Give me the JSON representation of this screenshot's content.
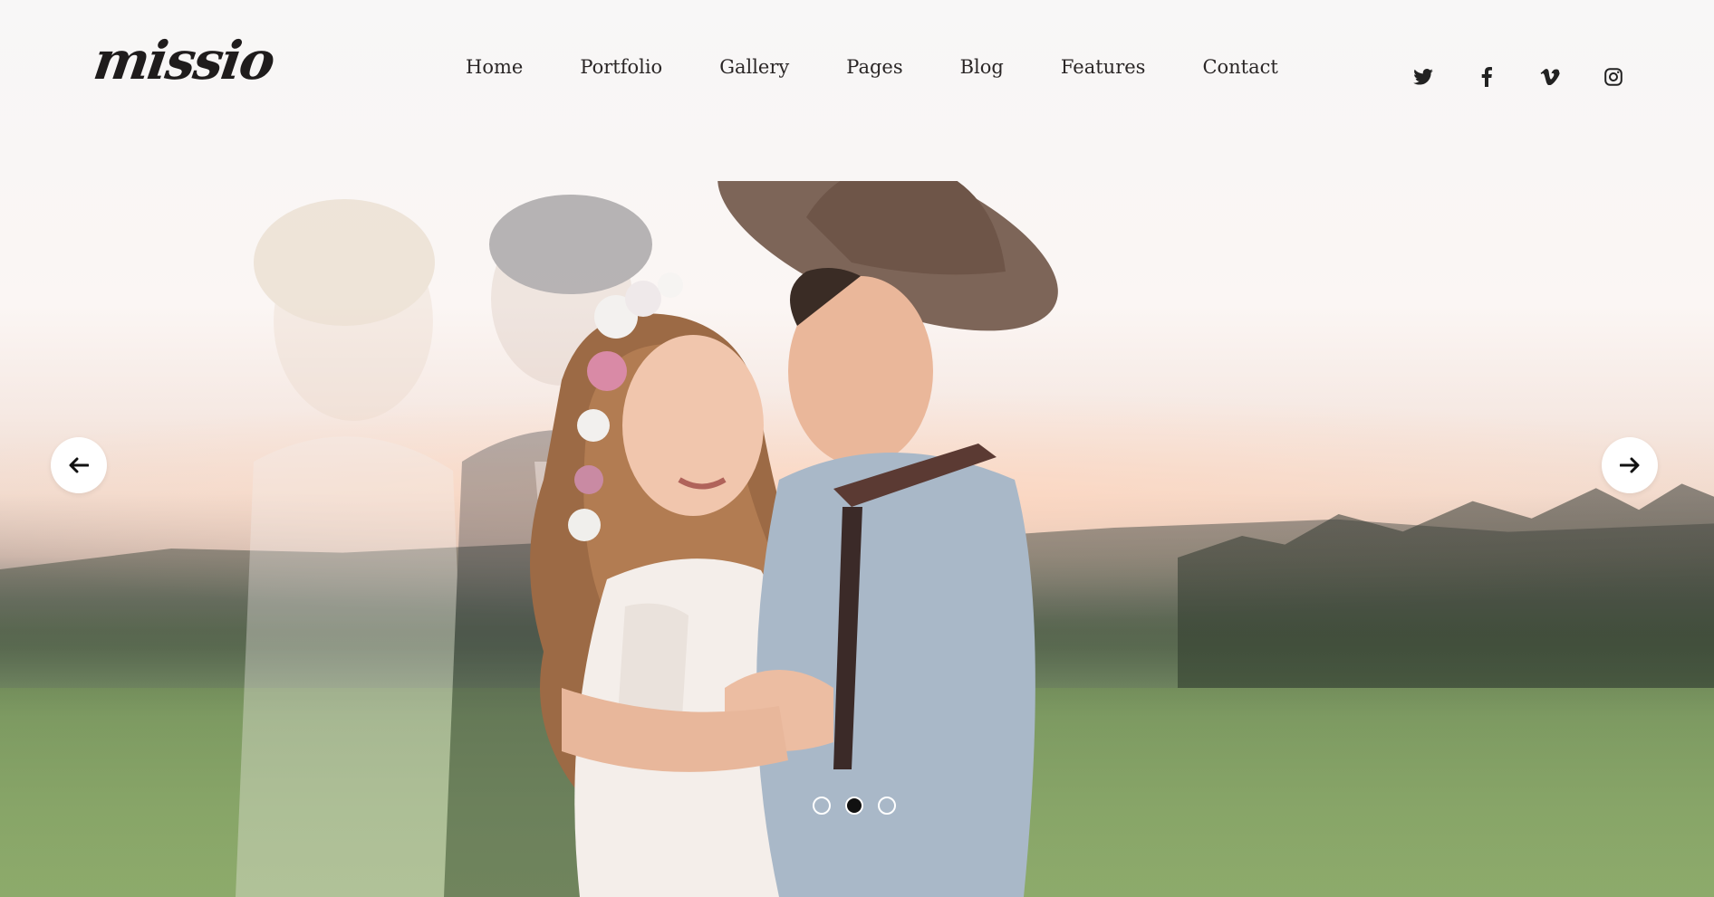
{
  "brand": {
    "logo_text": "missio"
  },
  "nav": {
    "items": [
      {
        "label": "Home"
      },
      {
        "label": "Portfolio"
      },
      {
        "label": "Gallery"
      },
      {
        "label": "Pages"
      },
      {
        "label": "Blog"
      },
      {
        "label": "Features"
      },
      {
        "label": "Contact"
      }
    ]
  },
  "social": {
    "icons": [
      "twitter-icon",
      "facebook-icon",
      "vimeo-icon",
      "instagram-icon"
    ]
  },
  "slider": {
    "prev_icon": "arrow-left-icon",
    "next_icon": "arrow-right-icon",
    "slide_count": 3,
    "active_slide": 2
  },
  "colors": {
    "text": "#2a2626",
    "accent_white": "#ffffff",
    "active_dot": "#111111"
  }
}
